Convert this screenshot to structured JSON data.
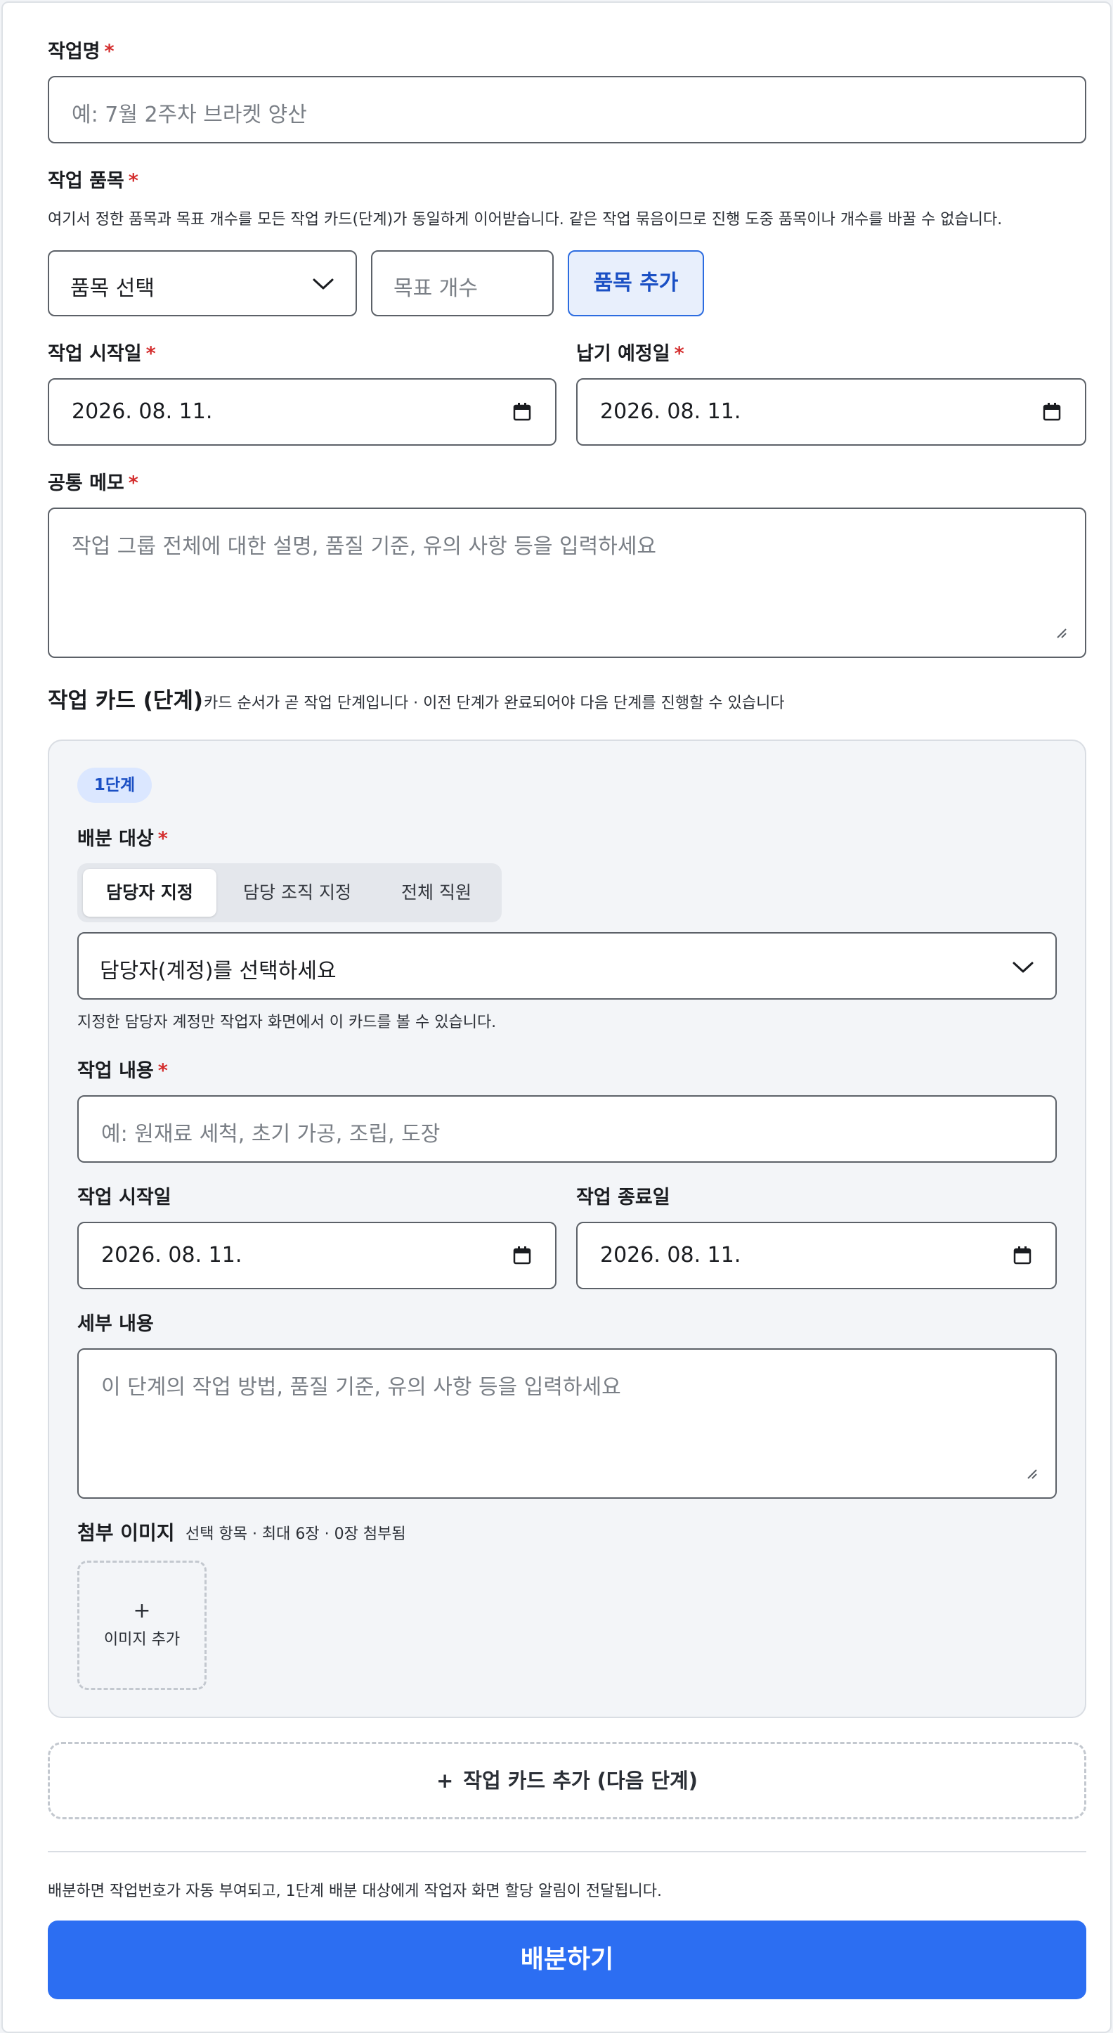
{
  "job": {
    "name_label": "작업명",
    "name_placeholder": "예: 7월 2주차 브라켓 양산"
  },
  "item": {
    "label": "작업 품목",
    "help": "여기서 정한 품목과 목표 개수를 모든 작업 카드(단계)가 동일하게 이어받습니다. 같은 작업 묶음이므로 진행 도중 품목이나 개수를 바꿀 수 없습니다.",
    "select_value": "품목 선택",
    "count_placeholder": "목표 개수",
    "add_label": "품목 추가"
  },
  "dates": {
    "start_label": "작업 시작일",
    "start_value": "2026. 08. 11.",
    "due_label": "납기 예정일",
    "due_value": "2026. 08. 11."
  },
  "memo": {
    "label": "공통 메모",
    "placeholder": "작업 그룹 전체에 대한 설명, 품질 기준, 유의 사항 등을 입력하세요"
  },
  "cards_section": {
    "title": "작업 카드 (단계)",
    "help": "카드 순서가 곧 작업 단계입니다 · 이전 단계가 완료되어야 다음 단계를 진행할 수 있습니다"
  },
  "stage": {
    "badge": "1단계",
    "assign_label": "배분 대상",
    "tabs": [
      "담당자 지정",
      "담당 조직 지정",
      "전체 직원"
    ],
    "assignee_value": "담당자(계정)를 선택하세요",
    "assign_help": "지정한 담당자 계정만 작업자 화면에서 이 카드를 볼 수 있습니다.",
    "content_label": "작업 내용",
    "content_placeholder": "예: 원재료 세척, 초기 가공, 조립, 도장",
    "start_label": "작업 시작일",
    "start_value": "2026. 08. 11.",
    "end_label": "작업 종료일",
    "end_value": "2026. 08. 11.",
    "detail_label": "세부 내용",
    "detail_placeholder": "이 단계의 작업 방법, 품질 기준, 유의 사항 등을 입력하세요",
    "images_label": "첨부 이미지",
    "images_help": "선택 항목 · 최대 6장 · 0장 첨부됨",
    "image_add_plus": "+",
    "image_add_label": "이미지 추가"
  },
  "add_card": {
    "plus": "+",
    "label": "작업 카드 추가 (다음 단계)"
  },
  "footer": {
    "note": "배분하면 작업번호가 자동 부여되고, 1단계 배분 대상에게 작업자 화면 할당 알림이 전달됩니다.",
    "submit_label": "배분하기"
  },
  "required_mark": "*",
  "colors": {
    "primary": "#2c6ef2",
    "required": "#d42d2d",
    "badge_bg": "#dbe7ff"
  }
}
